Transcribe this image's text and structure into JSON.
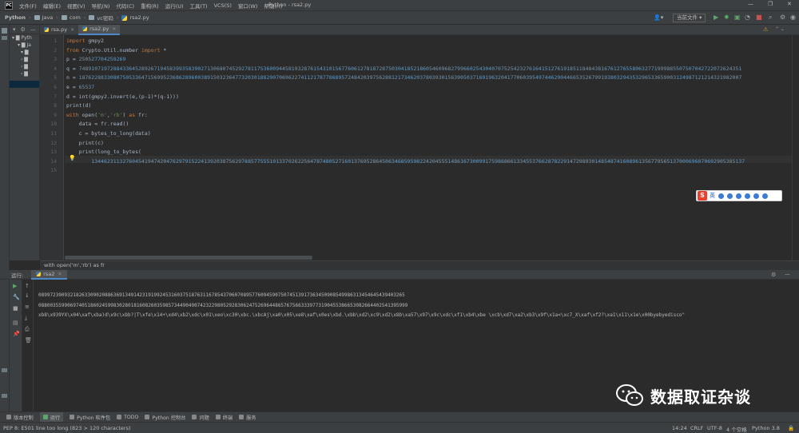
{
  "menubar": {
    "app_icon": "PC",
    "items": [
      "文件(F)",
      "编辑(E)",
      "视图(V)",
      "导航(N)",
      "代码(C)",
      "重构(R)",
      "运行(U)",
      "工具(T)",
      "VCS(S)",
      "窗口(W)",
      "帮助(H)"
    ],
    "window_title": "Python - rsa2.py",
    "minimize": "—",
    "restore": "❐",
    "close": "✕"
  },
  "navbar": {
    "crumbs": [
      "Python",
      "Java",
      "com",
      "vc密码",
      "rsa2.py"
    ],
    "run_config": "当前文件 ▾",
    "user_icon": "👤▾"
  },
  "project": {
    "items": [
      "Pyth",
      "Ja",
      "",
      "",
      "",
      ""
    ]
  },
  "tabs": [
    {
      "label": "rsa.py"
    },
    {
      "label": "rsa2.py"
    }
  ],
  "code": {
    "lines": [
      [
        {
          "c": "kw",
          "t": "import"
        },
        {
          "c": "fn",
          "t": " gmpy2"
        }
      ],
      [
        {
          "c": "kw",
          "t": "from"
        },
        {
          "c": "fn",
          "t": " Crypto.Util.number "
        },
        {
          "c": "kw",
          "t": "import"
        },
        {
          "c": "fn",
          "t": " *"
        }
      ],
      [
        {
          "c": "fn",
          "t": "p = "
        },
        {
          "c": "num",
          "t": "250527704258269"
        }
      ],
      [
        {
          "c": "fn",
          "t": "q = "
        },
        {
          "c": "num",
          "t": "74891071972884336452892671945839935839027130680745292781175360094458193287615431015677606127818728750304185218605460968279966025430407075254232761641512761918511848438167612765580632771999885507507042722072624351"
        }
      ],
      [
        {
          "c": "fn",
          "t": "n = "
        },
        {
          "c": "num",
          "t": "18762288330807505336471569952368628960038915032364773203018829070696227411217877868957248420397562881217346203780393015639050371691963204177060395497446290446653526799193803294353296533659003124987121214321982007"
        }
      ],
      [
        {
          "c": "fn",
          "t": "e = "
        },
        {
          "c": "num",
          "t": "65537"
        }
      ],
      [
        {
          "c": "fn",
          "t": "d = int(gmpy2.invert(e,(p-1)*(q-1)))"
        }
      ],
      [
        {
          "c": "fn",
          "t": "print(d)"
        }
      ],
      [
        {
          "c": "kw",
          "t": "with"
        },
        {
          "c": "fn",
          "t": " open("
        },
        {
          "c": "str",
          "t": "'m'"
        },
        {
          "c": "fn",
          "t": ","
        },
        {
          "c": "str",
          "t": "'rb'"
        },
        {
          "c": "fn",
          "t": ") "
        },
        {
          "c": "kw",
          "t": "as"
        },
        {
          "c": "fn",
          "t": " fr:"
        }
      ],
      [
        {
          "c": "fn",
          "t": "    data = fr.read()"
        }
      ],
      [
        {
          "c": "fn",
          "t": "    c = bytes_to_long(data)"
        }
      ],
      [
        {
          "c": "fn",
          "t": "    print(c)"
        }
      ],
      [
        {
          "c": "fn",
          "t": "    print(long_to_bytes("
        }
      ],
      [
        {
          "c": "num",
          "t": "        13446231132760454194742047629791522413920387562978857755510133702622564787480527160137695286450634685959822420455514861673009917598686613345537662878229147298930148548741608961356779565137000696070692905385137"
        }
      ],
      []
    ],
    "line_numbers": [
      "1",
      "2",
      "3",
      "4",
      "5",
      "6",
      "7",
      "8",
      "9",
      "10",
      "11",
      "12",
      "13",
      "14",
      "15"
    ]
  },
  "editor_crumb": "with open('m','rb') as fr",
  "ime": {
    "s": "S",
    "t": "英"
  },
  "run": {
    "label": "运行:",
    "tab": "rsa2",
    "output": [
      "0899723909321826330902088636913491423191992453160375187631167854370607089577609459075074513917363450908549986313454645439403265",
      "08800355990697405186024599830280181608260359857344904907423229805292830624752696448657675663339773190455386653082664402541395999",
      "xb8\\x939YX\\x04\\xaf\\xba)d\\x9c\\xbb?|T\\xfe\\x14+\\xd4\\xb2\\xdc\\x01\\xeo\\xc30\\xbc.\\xbcAj\\xa0\\x05\\xe8\\xaf\\x0es\\xbd.\\xbb\\xd2\\xc9\\xd2\\x8b\\xa57\\x97\\x9c\\xdc\\xf1\\xb4\\xbe \\xcb\\xd7\\xa2\\xb3\\x9f\\x1a<\\xc7_X\\xaf\\xf2?\\xa1\\x11\\x1e\\x00byebyedisco\""
    ]
  },
  "watermark": "数据取证杂谈",
  "bottom_tools": [
    "版本控制",
    "运行",
    "Python 软件包",
    "TODO",
    "Python 控制台",
    "问题",
    "终端",
    "服务"
  ],
  "status": {
    "message": "PEP 8: E501 line too long (823 > 120 characters)",
    "position": "14:24",
    "line_sep": "CRLF",
    "encoding": "UTF-8",
    "indent": "4 个空格",
    "interpreter": "Python 3.8"
  },
  "colors": {
    "keyword": "#cc7832",
    "number": "#6897bb",
    "string": "#6a8759",
    "accent": "#4a88c7"
  }
}
